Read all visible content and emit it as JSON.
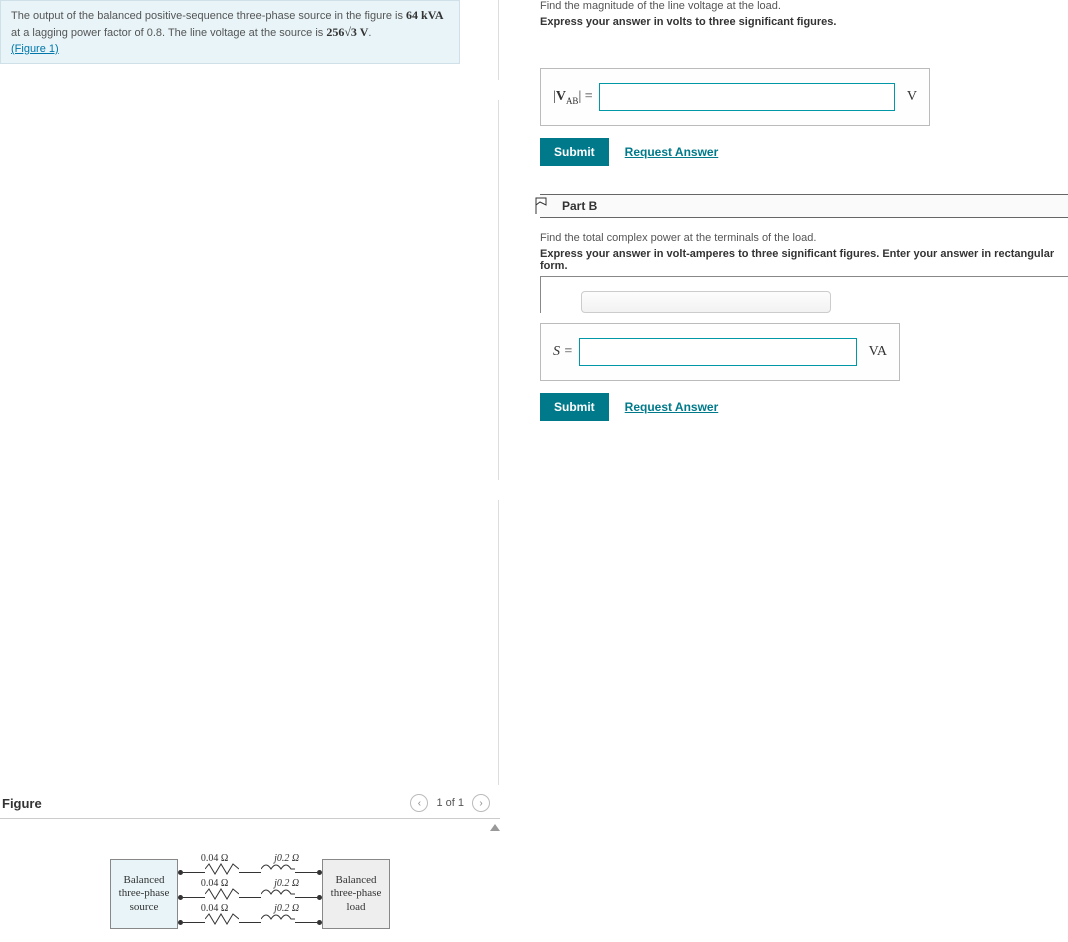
{
  "problem": {
    "intro_prefix": "The output of the balanced positive-sequence three-phase source in the figure is ",
    "power": "64 kVA",
    "intro_mid": " at a lagging power factor of 0.8. The line voltage at the source is ",
    "voltage": "256√3 V",
    "intro_suffix": ".",
    "figure_link": "(Figure 1)"
  },
  "partA": {
    "instruction1": "Find the magnitude of the line voltage at the load.",
    "instruction2": "Express your answer in volts to three significant figures.",
    "label_html": "|V_AB| =",
    "value": "",
    "unit": "V",
    "submit": "Submit",
    "request": "Request Answer"
  },
  "partB": {
    "title": "Part B",
    "instruction1": "Find the total complex power at the terminals of the load.",
    "instruction2": "Express your answer in volt-amperes to three significant figures. Enter your answer in rectangular form.",
    "label": "S =",
    "value": "",
    "unit": "VA",
    "submit": "Submit",
    "request": "Request Answer"
  },
  "figure": {
    "title": "Figure",
    "pager": "1 of 1",
    "src_label_1": "Balanced",
    "src_label_2": "three-phase",
    "src_label_3": "source",
    "load_label_1": "Balanced",
    "load_label_2": "three-phase",
    "load_label_3": "load",
    "r_val": "0.04 Ω",
    "x_val": "j0.2 Ω"
  }
}
